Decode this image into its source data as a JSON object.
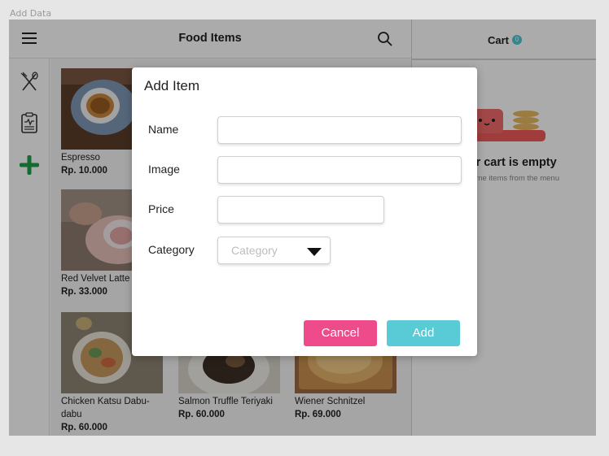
{
  "frame_label": "Add Data",
  "header": {
    "title": "Food Items"
  },
  "cart": {
    "title": "Cart",
    "count": "0",
    "empty_title": "Your cart is empty",
    "empty_subtitle": "Add some items from the menu"
  },
  "sidebar": {
    "items": [
      "food-menu-icon",
      "report-clipboard-icon",
      "add-plus-icon"
    ]
  },
  "items": [
    {
      "name": "Espresso",
      "price": "Rp. 10.000"
    },
    {
      "name": "Red Velvet Latte",
      "price": "Rp. 33.000"
    },
    {
      "name": "Chicken Katsu Dabu-dabu",
      "price": "Rp. 60.000"
    },
    {
      "name": "Salmon Truffle Teriyaki",
      "price": "Rp. 60.000"
    },
    {
      "name": "Wiener Schnitzel",
      "price": "Rp. 69.000"
    }
  ],
  "modal": {
    "title": "Add Item",
    "name_label": "Name",
    "image_label": "Image",
    "price_label": "Price",
    "category_label": "Category",
    "category_placeholder": "Category",
    "cancel_label": "Cancel",
    "add_label": "Add"
  },
  "colors": {
    "cancel": "#ee4b8a",
    "add": "#58cbd6",
    "accent": "#4ec8d4",
    "plus": "#1f9e4a"
  }
}
